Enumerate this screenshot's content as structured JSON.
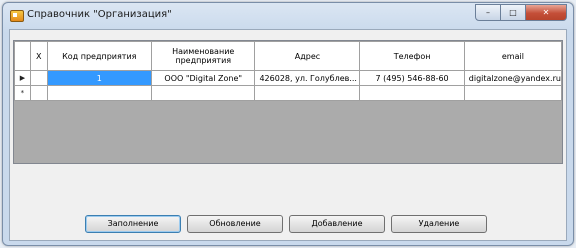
{
  "window": {
    "title": "Справочник \"Организация\"",
    "controls": {
      "minimize": "–",
      "maximize": "□",
      "close": "✕"
    }
  },
  "grid": {
    "columns": [
      "X",
      "Код предприятия",
      "Наименование предприятия",
      "Адрес",
      "Телефон",
      "email"
    ],
    "rows": [
      {
        "indicator": "▶",
        "cells": [
          "",
          "1",
          "ООО \"Digital Zone\"",
          "426028, ул. Голублев...",
          "7 (495) 546-88-60",
          "digitalzone@yandex.ru"
        ]
      },
      {
        "indicator": "*",
        "cells": [
          "",
          "",
          "",
          "",
          "",
          ""
        ]
      }
    ]
  },
  "buttons": {
    "fill": "Заполнение",
    "refresh": "Обновление",
    "add": "Добавление",
    "delete": "Удаление"
  },
  "colors": {
    "selection": "#3399ff",
    "grid_background": "#ababab",
    "close_button": "#c44f38"
  }
}
